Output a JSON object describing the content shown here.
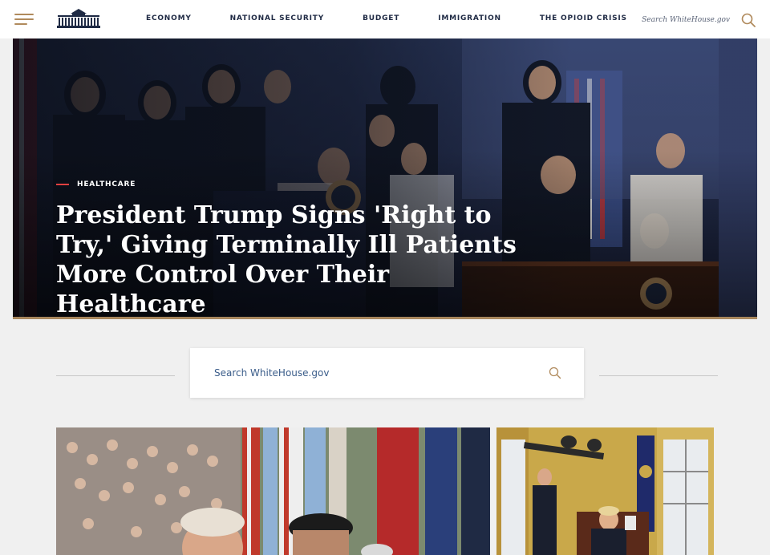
{
  "header": {
    "nav": [
      {
        "label": "ECONOMY"
      },
      {
        "label": "NATIONAL SECURITY"
      },
      {
        "label": "BUDGET"
      },
      {
        "label": "IMMIGRATION"
      },
      {
        "label": "THE OPIOID CRISIS"
      }
    ],
    "search_text": "Search WhiteHouse.gov"
  },
  "hero": {
    "category": "HEALTHCARE",
    "title": "President Trump Signs 'Right to Try,' Giving Terminally Ill Patients More Control Over Their Healthcare"
  },
  "search": {
    "placeholder": "Search WhiteHouse.gov"
  },
  "colors": {
    "accent_gold": "#b08a5c",
    "accent_red": "#e04040",
    "navy": "#1f2a44",
    "search_text": "#3b5d8a"
  },
  "icons": [
    "menu-icon",
    "white-house-logo",
    "search-icon"
  ]
}
